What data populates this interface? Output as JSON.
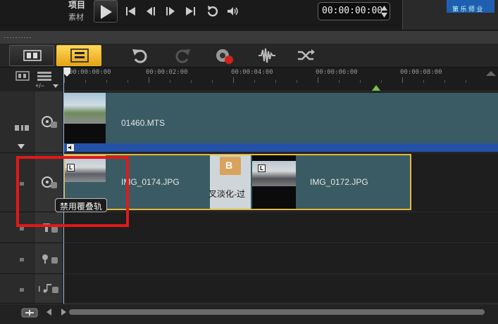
{
  "transport": {
    "project_label": "项目",
    "clip_label": "素材",
    "timecode": "00:00:00:00",
    "controls": [
      "play-icon",
      "go-start-icon",
      "prev-frame-icon",
      "next-frame-icon",
      "go-end-icon",
      "repeat-icon",
      "volume-icon"
    ]
  },
  "preview": {
    "thumb_text": "第 乐 师 业"
  },
  "toolbar": {
    "buttons": [
      "storyboard-view-icon",
      "timeline-view-icon",
      "undo-icon",
      "redo-icon",
      "record-capture-icon",
      "audio-mixer-icon",
      "auto-music-icon"
    ]
  },
  "ruler": {
    "zoom_label": "+/−",
    "ticks": [
      "00:00:00:00",
      "00:00:02:00",
      "00:00:04:00",
      "00:00:06:00",
      "00:00:08:00"
    ]
  },
  "tracks": {
    "video": {
      "clip_name": "01460.MTS"
    },
    "overlay": {
      "clips": [
        {
          "name": "IMG_0174.JPG",
          "badge": "L"
        },
        {
          "name": "IMG_0172.JPG",
          "badge": "L"
        }
      ],
      "transition_label": "叉淡化-过",
      "transition_badge": "B"
    }
  },
  "tooltip": {
    "text": "禁用覆叠轨"
  },
  "colors": {
    "clip": "#3a5b63",
    "highlight": "#e01919",
    "active_tab": "#f5b82a",
    "audio_bar": "#2552a8"
  }
}
